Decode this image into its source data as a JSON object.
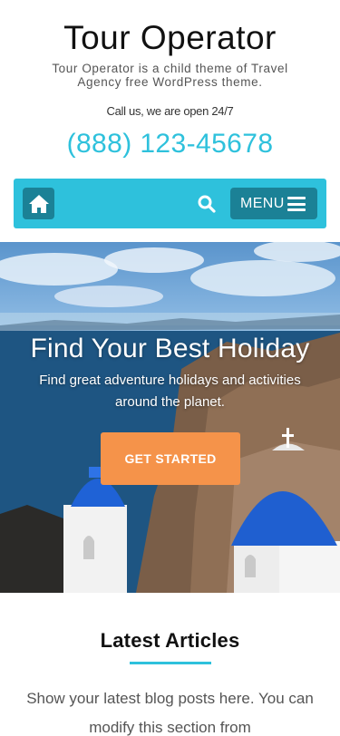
{
  "header": {
    "site_title": "Tour Operator",
    "tagline": "Tour Operator is a child theme of Travel Agency free WordPress theme.",
    "call_text": "Call us, we are open 24/7",
    "phone": "(888) 123-45678"
  },
  "nav": {
    "home_icon": "home-icon",
    "search_icon": "search-icon",
    "menu_label": "MENU",
    "menu_icon": "hamburger-icon"
  },
  "hero": {
    "title": "Find Your Best Holiday",
    "subtitle": "Find great adventure holidays and activities around the planet.",
    "cta_label": "GET STARTED"
  },
  "articles": {
    "title": "Latest Articles",
    "description": "Show your latest blog posts here. You can modify this section from"
  },
  "colors": {
    "accent": "#2ec1dc",
    "accent_dark": "#1b8196",
    "cta": "#f5934a"
  }
}
